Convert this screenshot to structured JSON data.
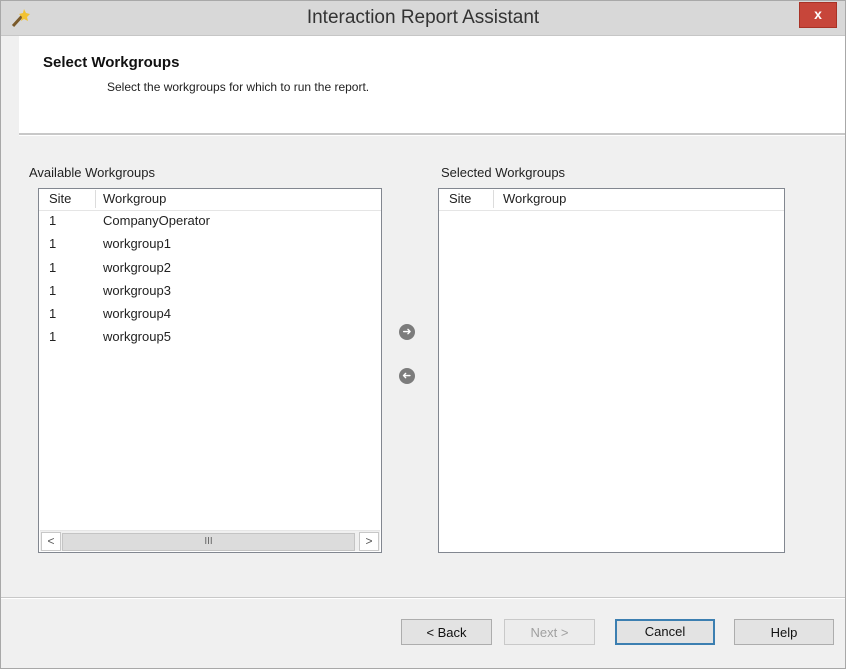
{
  "window": {
    "title": "Interaction Report Assistant",
    "close_label": "x"
  },
  "header": {
    "title": "Select Workgroups",
    "subtitle": "Select the workgroups for which to run the report."
  },
  "available": {
    "label": "Available Workgroups",
    "columns": [
      "Site",
      "Workgroup"
    ],
    "rows": [
      {
        "site": "1",
        "workgroup": "CompanyOperator"
      },
      {
        "site": "1",
        "workgroup": "workgroup1"
      },
      {
        "site": "1",
        "workgroup": "workgroup2"
      },
      {
        "site": "1",
        "workgroup": "workgroup3"
      },
      {
        "site": "1",
        "workgroup": "workgroup4"
      },
      {
        "site": "1",
        "workgroup": "workgroup5"
      }
    ],
    "scroll_left": "<",
    "scroll_right": ">",
    "scroll_thumb": "III"
  },
  "selected": {
    "label": "Selected Workgroups",
    "columns": [
      "Site",
      "Workgroup"
    ],
    "rows": []
  },
  "transfer": {
    "add_icon": "arrow-right-circle",
    "remove_icon": "arrow-left-circle"
  },
  "buttons": {
    "back": "< Back",
    "next": "Next >",
    "cancel": "Cancel",
    "help": "Help"
  },
  "colors": {
    "close": "#c7463a",
    "default_button_border": "#3c7fb1"
  }
}
